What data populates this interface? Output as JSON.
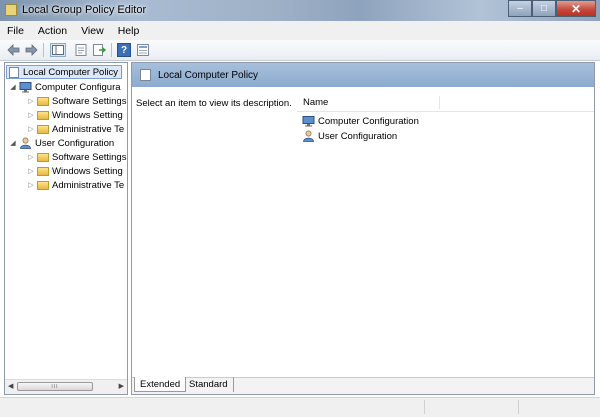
{
  "window": {
    "title": "Local Group Policy Editor"
  },
  "window_controls": {
    "minimize": "–",
    "maximize": "□",
    "close": "✕"
  },
  "menu": [
    "File",
    "Action",
    "View",
    "Help"
  ],
  "toolbar": {
    "help_glyph": "?"
  },
  "tree": {
    "root": "Local Computer Policy",
    "computer": {
      "label": "Computer Configura",
      "children": [
        "Software Settings",
        "Windows Setting",
        "Administrative Te"
      ]
    },
    "user": {
      "label": "User Configuration",
      "children": [
        "Software Settings",
        "Windows Setting",
        "Administrative Te"
      ]
    },
    "scroll_grip": "III"
  },
  "right": {
    "header": "Local Computer Policy",
    "description": "Select an item to view its description.",
    "column_name": "Name",
    "items": [
      "Computer Configuration",
      "User Configuration"
    ]
  },
  "tabs": [
    "Extended",
    "Standard"
  ],
  "colors": {
    "header": "#9ab5d6",
    "selection": "#dde8f6"
  }
}
